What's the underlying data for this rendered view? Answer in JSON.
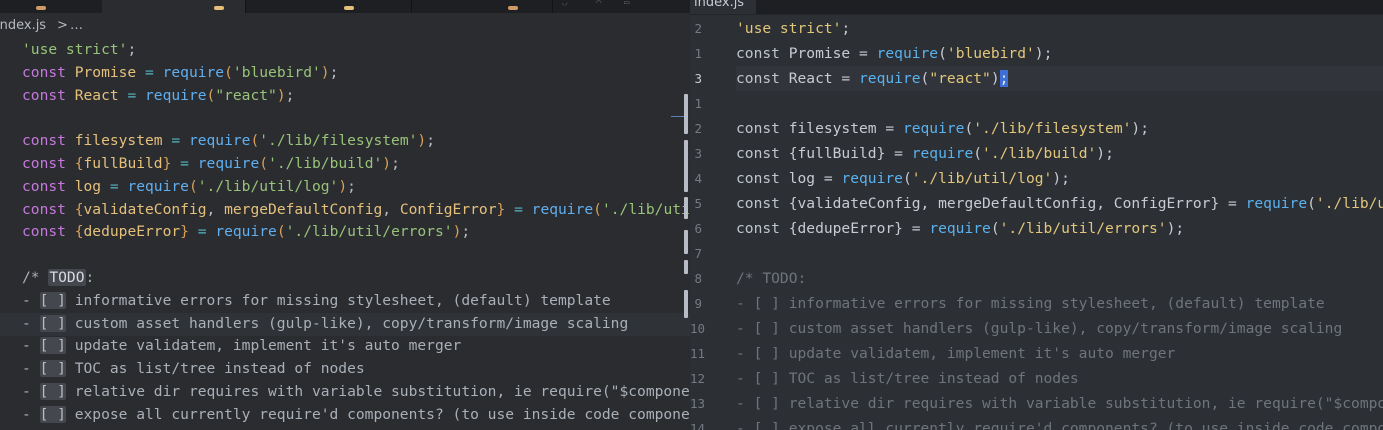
{
  "left_pane": {
    "breadcrumb": {
      "file": "index.js",
      "separator": ">",
      "more": "…"
    },
    "lines": [
      [
        [
          "str",
          "'use strict'"
        ],
        [
          "pn",
          ";"
        ]
      ],
      [
        [
          "kw",
          "const "
        ],
        [
          "vr",
          "Promise"
        ],
        [
          "op",
          " = "
        ],
        [
          "fn",
          "require"
        ],
        [
          "brk",
          "("
        ],
        [
          "str",
          "'bluebird'"
        ],
        [
          "brk",
          ")"
        ],
        [
          "pn",
          ";"
        ]
      ],
      [
        [
          "kw",
          "const "
        ],
        [
          "vr",
          "React"
        ],
        [
          "op",
          " = "
        ],
        [
          "fn",
          "require"
        ],
        [
          "brk",
          "("
        ],
        [
          "str",
          "\"react\""
        ],
        [
          "brk",
          ")"
        ],
        [
          "pn",
          ";"
        ]
      ],
      [],
      [
        [
          "kw",
          "const "
        ],
        [
          "vr",
          "filesystem"
        ],
        [
          "op",
          " = "
        ],
        [
          "fn",
          "require"
        ],
        [
          "brk",
          "("
        ],
        [
          "str",
          "'./lib/filesystem'"
        ],
        [
          "brk",
          ")"
        ],
        [
          "pn",
          ";"
        ]
      ],
      [
        [
          "kw",
          "const "
        ],
        [
          "brk",
          "{"
        ],
        [
          "vr",
          "fullBuild"
        ],
        [
          "brk",
          "}"
        ],
        [
          "op",
          " = "
        ],
        [
          "fn",
          "require"
        ],
        [
          "brk",
          "("
        ],
        [
          "str",
          "'./lib/build'"
        ],
        [
          "brk",
          ")"
        ],
        [
          "pn",
          ";"
        ]
      ],
      [
        [
          "kw",
          "const "
        ],
        [
          "vr",
          "log"
        ],
        [
          "op",
          " = "
        ],
        [
          "fn",
          "require"
        ],
        [
          "brk",
          "("
        ],
        [
          "str",
          "'./lib/util/log'"
        ],
        [
          "brk",
          ")"
        ],
        [
          "pn",
          ";"
        ]
      ],
      [
        [
          "kw",
          "const "
        ],
        [
          "brk",
          "{"
        ],
        [
          "vr",
          "validateConfig"
        ],
        [
          "pn",
          ", "
        ],
        [
          "vr",
          "mergeDefaultConfig"
        ],
        [
          "pn",
          ", "
        ],
        [
          "cls",
          "ConfigError"
        ],
        [
          "brk",
          "}"
        ],
        [
          "op",
          " = "
        ],
        [
          "fn",
          "require"
        ],
        [
          "brk",
          "("
        ],
        [
          "str",
          "'./lib/util/errors'"
        ]
      ],
      [
        [
          "kw",
          "const "
        ],
        [
          "brk",
          "{"
        ],
        [
          "vr",
          "dedupeError"
        ],
        [
          "brk",
          "}"
        ],
        [
          "op",
          " = "
        ],
        [
          "fn",
          "require"
        ],
        [
          "brk",
          "("
        ],
        [
          "str",
          "'./lib/util/errors'"
        ],
        [
          "brk",
          ")"
        ],
        [
          "pn",
          ";"
        ]
      ],
      [],
      [
        [
          "cm",
          "/* "
        ],
        [
          "todo",
          "TODO"
        ],
        [
          "cm",
          ":"
        ]
      ],
      [
        [
          "cm",
          "- "
        ],
        [
          "box",
          "[ ]"
        ],
        [
          "cm",
          " informative errors for missing stylesheet, (default) template"
        ]
      ],
      [
        [
          "cm",
          "- "
        ],
        [
          "box",
          "[ ]"
        ],
        [
          "cm",
          " custom asset handlers (gulp-like), copy/transform/image scaling"
        ]
      ],
      [
        [
          "cm",
          "- "
        ],
        [
          "box",
          "[ ]"
        ],
        [
          "cm",
          " update validatem, implement it's auto merger"
        ]
      ],
      [
        [
          "cm",
          "- "
        ],
        [
          "box",
          "[ ]"
        ],
        [
          "cm",
          " TOC as list/tree instead of nodes"
        ]
      ],
      [
        [
          "cm",
          "- "
        ],
        [
          "box",
          "[ ]"
        ],
        [
          "cm",
          " relative dir requires with variable substitution, ie require(\"$components/"
        ]
      ],
      [
        [
          "cm",
          "- "
        ],
        [
          "box",
          "[ ]"
        ],
        [
          "cm",
          " expose all currently require'd components? (to use inside code components)"
        ]
      ]
    ]
  },
  "right_pane": {
    "tab_label": "index.js",
    "line_numbers": [
      "2",
      "1",
      "3",
      "1",
      "2",
      "3",
      "4",
      "5",
      "6",
      "7",
      "8",
      "9",
      "10",
      "11",
      "12",
      "13",
      "14"
    ],
    "active_line_number": "3",
    "lines": [
      [
        [
          "str",
          "'use strict'"
        ],
        [
          "tx",
          ";"
        ]
      ],
      [
        [
          "kw",
          "const "
        ],
        [
          "tx",
          "Promise = "
        ],
        [
          "fn",
          "require"
        ],
        [
          "tx",
          "("
        ],
        [
          "str",
          "'bluebird'"
        ],
        [
          "tx",
          ");"
        ]
      ],
      [
        [
          "kw",
          "const "
        ],
        [
          "tx",
          "React = "
        ],
        [
          "fn",
          "require"
        ],
        [
          "tx",
          "("
        ],
        [
          "str",
          "\"react\""
        ],
        [
          "tx",
          ")"
        ],
        [
          "caret",
          ";"
        ]
      ],
      [],
      [
        [
          "kw",
          "const "
        ],
        [
          "tx",
          "filesystem = "
        ],
        [
          "fn",
          "require"
        ],
        [
          "tx",
          "("
        ],
        [
          "str",
          "'./lib/filesystem'"
        ],
        [
          "tx",
          ");"
        ]
      ],
      [
        [
          "kw",
          "const "
        ],
        [
          "tx",
          "{fullBuild} = "
        ],
        [
          "fn",
          "require"
        ],
        [
          "tx",
          "("
        ],
        [
          "str",
          "'./lib/build'"
        ],
        [
          "tx",
          ");"
        ]
      ],
      [
        [
          "kw",
          "const "
        ],
        [
          "tx",
          "log = "
        ],
        [
          "fn",
          "require"
        ],
        [
          "tx",
          "("
        ],
        [
          "str",
          "'./lib/util/log'"
        ],
        [
          "tx",
          ");"
        ]
      ],
      [
        [
          "kw",
          "const "
        ],
        [
          "tx",
          "{validateConfig, mergeDefaultConfig, ConfigError} = "
        ],
        [
          "fn",
          "require"
        ],
        [
          "tx",
          "("
        ],
        [
          "str",
          "'./lib/util/errors'"
        ]
      ],
      [
        [
          "kw",
          "const "
        ],
        [
          "tx",
          "{dedupeError} = "
        ],
        [
          "fn",
          "require"
        ],
        [
          "tx",
          "("
        ],
        [
          "str",
          "'./lib/util/errors'"
        ],
        [
          "tx",
          ");"
        ]
      ],
      [],
      [
        [
          "cm",
          "/* TODO:"
        ]
      ],
      [
        [
          "cm",
          "- [ ] informative errors for missing stylesheet, (default) template"
        ]
      ],
      [
        [
          "cm",
          "- [ ] custom asset handlers (gulp-like), copy/transform/image scaling"
        ]
      ],
      [
        [
          "cm",
          "- [ ] update validatem, implement it's auto merger"
        ]
      ],
      [
        [
          "cm",
          "- [ ] TOC as list/tree instead of nodes"
        ]
      ],
      [
        [
          "cm",
          "- [ ] relative dir requires with variable substitution, ie require(\"$components/"
        ]
      ],
      [
        [
          "cm",
          "- [ ] expose all currently require'd components? (to use inside code components)"
        ]
      ]
    ]
  },
  "colors": {
    "tab_dot_1": "#d19a66",
    "tab_dot_2": "#e5c07b",
    "tab_dot_3": "#e5c07b",
    "tab_dot_4": "#d19a66",
    "caret": "#3d6fd6"
  }
}
